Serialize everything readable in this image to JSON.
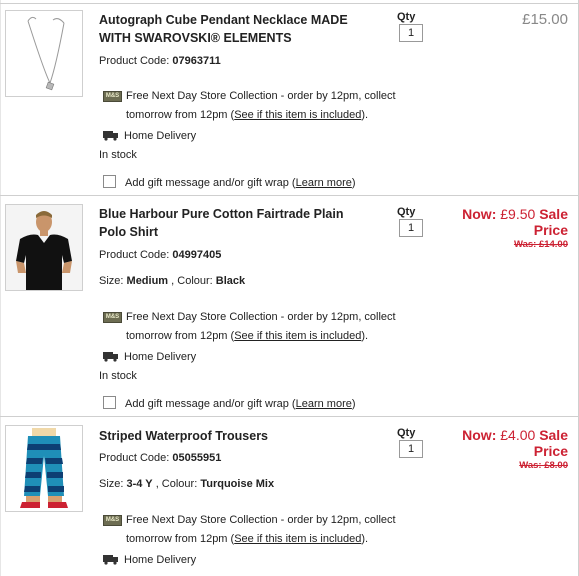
{
  "items": [
    {
      "name": "Autograph Cube Pendant Necklace MADE WITH SWAROVSKI® ELEMENTS",
      "code_label": "Product Code:",
      "code": "07963711",
      "collection_text": "Free Next Day Store Collection - order by 12pm, collect tomorrow from 12pm",
      "collection_link": "See if this item is included",
      "home_delivery": "Home Delivery",
      "stock": "In stock",
      "gift_text": "Add gift message and/or gift wrap",
      "gift_link": "Learn more",
      "qty_label": "Qty",
      "qty": "1",
      "price": "£15.00"
    },
    {
      "name": "Blue Harbour Pure Cotton Fairtrade Plain Polo Shirt",
      "code_label": "Product Code:",
      "code": "04997405",
      "size_label": "Size:",
      "size": "Medium",
      "colour_label": ", Colour:",
      "colour": "Black",
      "collection_text": "Free Next Day Store Collection - order by 12pm, collect tomorrow from 12pm",
      "collection_link": "See if this item is included",
      "home_delivery": "Home Delivery",
      "stock": "In stock",
      "gift_text": "Add gift message and/or gift wrap",
      "gift_link": "Learn more",
      "qty_label": "Qty",
      "qty": "1",
      "now_label": "Now:",
      "now_price": "£9.50",
      "sale_label": "Sale Price",
      "was": "Was: £14.00"
    },
    {
      "name": "Striped Waterproof Trousers",
      "code_label": "Product Code:",
      "code": "05055951",
      "size_label": "Size:",
      "size": "3-4 Y",
      "colour_label": ", Colour:",
      "colour": "Turquoise Mix",
      "collection_text": "Free Next Day Store Collection - order by 12pm, collect tomorrow from 12pm",
      "collection_link": "See if this item is included",
      "home_delivery": "Home Delivery",
      "qty_label": "Qty",
      "qty": "1",
      "now_label": "Now:",
      "now_price": "£4.00",
      "sale_label": "Sale Price",
      "was": "Was: £8.00"
    }
  ],
  "logo_text": "M&S",
  "colors": {
    "sale_red": "#cc2233",
    "price_grey": "#888888",
    "border": "#cfcfcf"
  },
  "icons": [
    "store-collection-icon",
    "truck-icon",
    "checkbox"
  ]
}
